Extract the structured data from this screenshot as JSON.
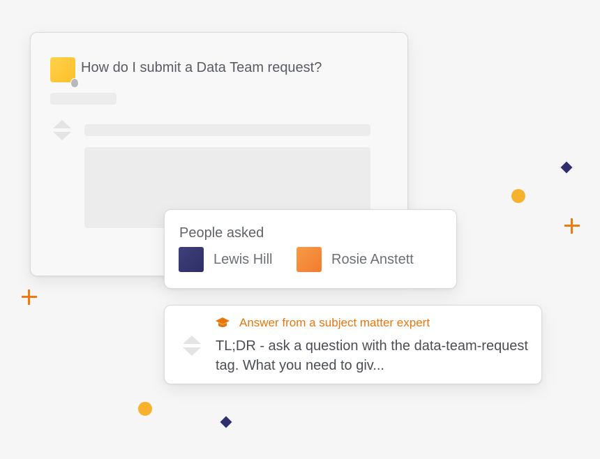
{
  "question": {
    "title": "How do I submit a Data Team request?",
    "avatar_color": "#fcc830"
  },
  "people_asked": {
    "title": "People asked",
    "people": [
      {
        "name": "Lewis Hill",
        "avatar_color": "#38386f"
      },
      {
        "name": "Rosie Anstett",
        "avatar_color": "#f5883a"
      }
    ]
  },
  "answer": {
    "label": "Answer from a subject matter expert",
    "label_icon": "graduation-cap-icon",
    "text": "TL;DR - ask a question with the data-team-request tag. What you need to giv...",
    "accent_color": "#e8760e"
  },
  "decorations": {
    "plus_color": "#ef7a10",
    "dot_color": "#f7b22d",
    "diamond_color": "#2f2f6e"
  }
}
